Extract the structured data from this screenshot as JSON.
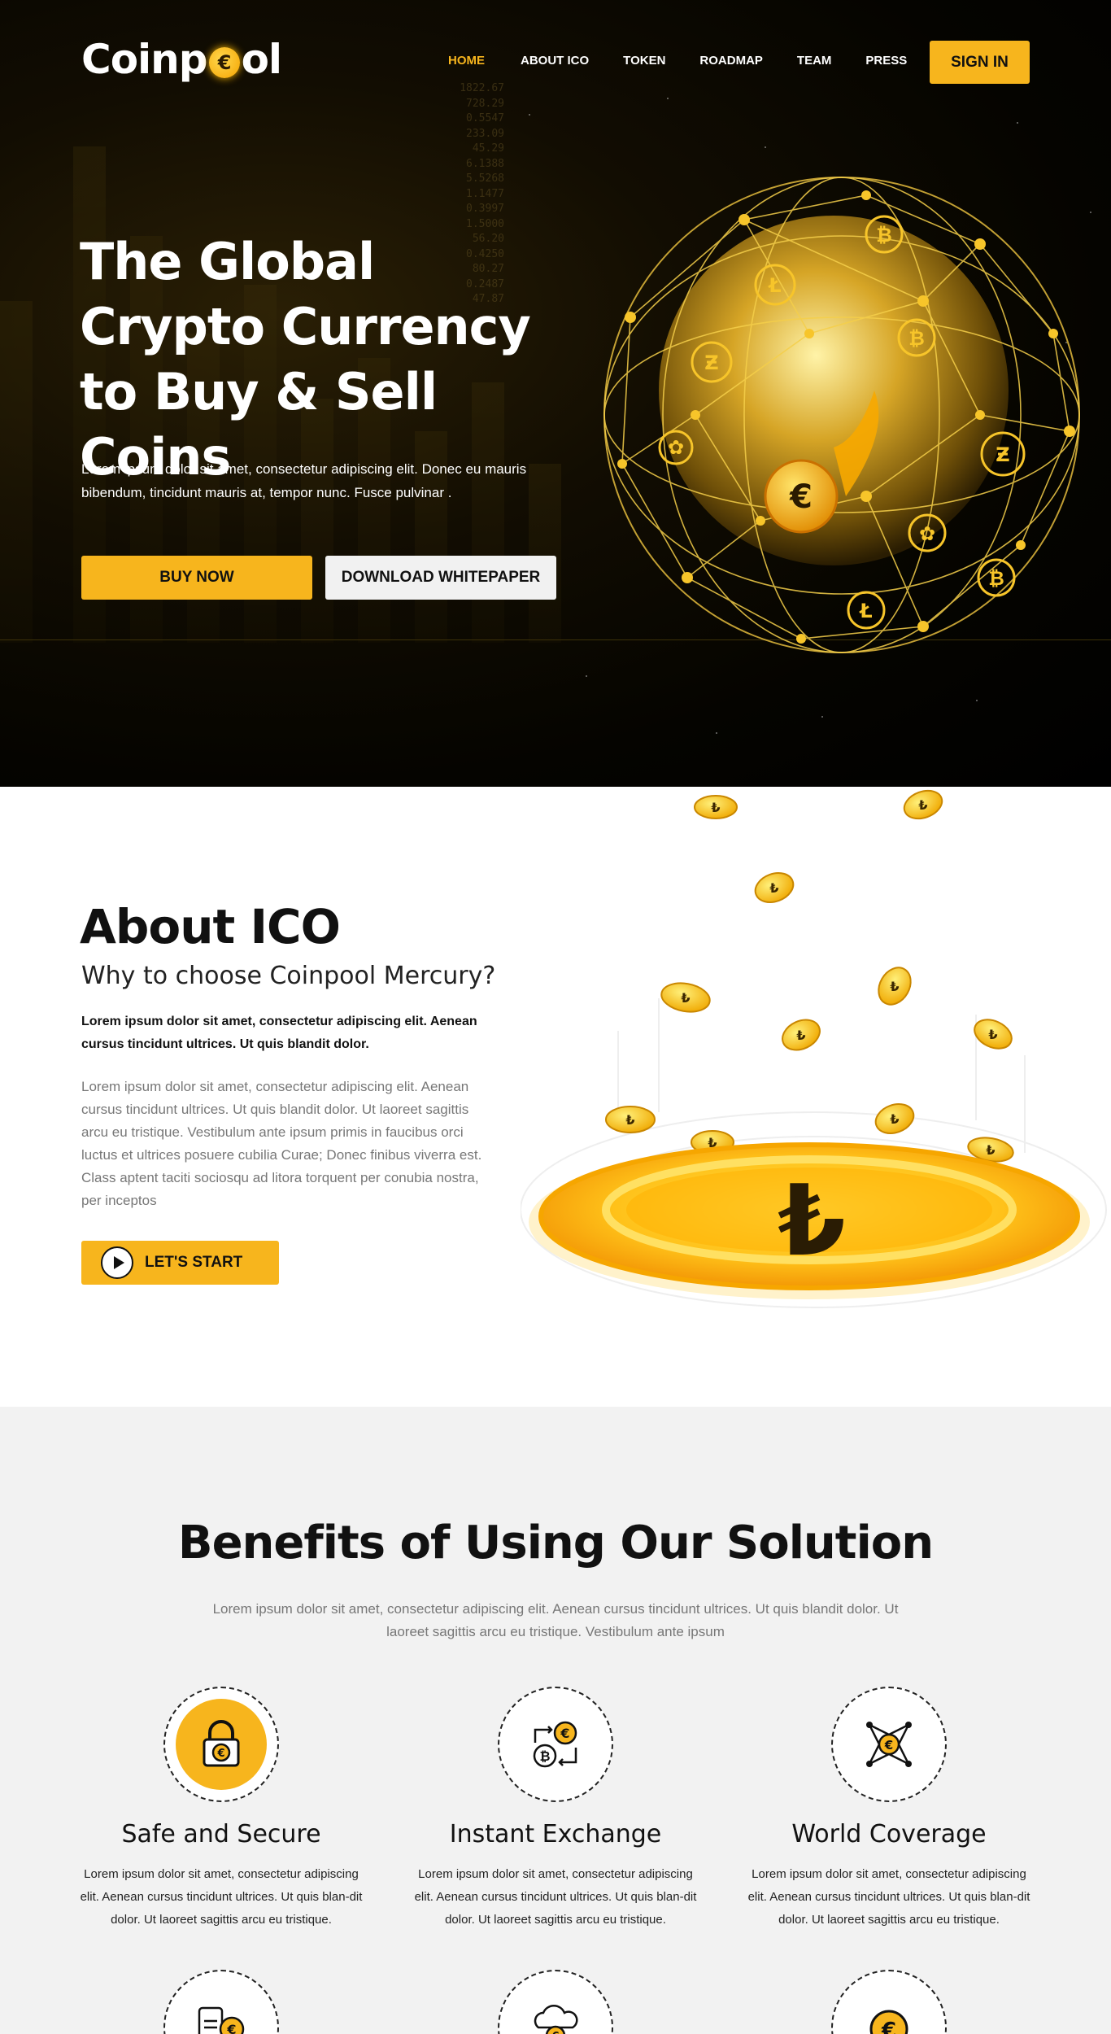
{
  "header": {
    "logo_left": "Coinp",
    "logo_coin": "€",
    "logo_right": "ol",
    "nav": [
      {
        "label": "HOME",
        "active": true
      },
      {
        "label": "ABOUT  ICO",
        "active": false
      },
      {
        "label": "TOKEN",
        "active": false
      },
      {
        "label": "ROADMAP",
        "active": false
      },
      {
        "label": "TEAM",
        "active": false
      },
      {
        "label": "PRESS",
        "active": false
      }
    ],
    "signin_label": "SIGN IN"
  },
  "hero": {
    "title_line1": "The Global",
    "title_line2": "Crypto Currency",
    "title_line3": "to Buy & Sell Coins",
    "text": "Lorem ipsum dolor sit amet, consectetur adipiscing elit. Donec eu mauris bibendum, tincidunt mauris at, tempor nunc. Fusce pulvinar .",
    "buy_label": "BUY NOW",
    "whitepaper_label": "DOWNLOAD WHITEPAPER",
    "ticker": [
      "1822.67",
      "728.29",
      "0.5547",
      "233.09",
      "45.29",
      "6.1388",
      "5.5268",
      "1.1477",
      "0.3997",
      "1.5000",
      "56.20",
      "0.4250",
      "80.27",
      "0.2487",
      "47.87"
    ]
  },
  "about": {
    "title": "About ICO",
    "subtitle": "Why to choose Coinpool Mercury?",
    "lead": "Lorem ipsum dolor sit amet, consectetur adipiscing elit. Aenean cursus tincidunt ultrices. Ut quis blandit dolor.",
    "body": "Lorem ipsum dolor sit amet, consectetur adipiscing elit. Aenean cursus tincidunt ultrices. Ut quis blandit dolor. Ut laoreet sagittis arcu eu tristique. Vestibulum ante ipsum primis in faucibus orci luctus et ultrices posuere cubilia Curae; Donec finibus viverra est. Class aptent taciti sociosqu ad litora torquent per conubia nostra, per inceptos",
    "start_label": "LET'S START",
    "big_coin_symbol": "₺"
  },
  "benefits": {
    "title": "Benefits of Using Our Solution",
    "intro": "Lorem ipsum dolor sit amet, consectetur adipiscing elit. Aenean cursus tincidunt ultrices. Ut quis blandit dolor. Ut laoreet sagittis arcu eu tristique. Vestibulum ante ipsum",
    "features": [
      {
        "title": "Safe and Secure",
        "text": "Lorem ipsum dolor sit amet, consectetur adipiscing elit. Aenean cursus tincidunt ultrices. Ut quis blan-dit dolor. Ut laoreet sagittis arcu eu tristique.",
        "icon": "lock-coin-icon"
      },
      {
        "title": "Instant Exchange",
        "text": "Lorem ipsum dolor sit amet, consectetur adipiscing elit. Aenean cursus tincidunt ultrices. Ut quis blan-dit dolor. Ut laoreet sagittis arcu eu tristique.",
        "icon": "exchange-icon"
      },
      {
        "title": "World Coverage",
        "text": "Lorem ipsum dolor sit amet, consectetur adipiscing elit. Aenean cursus tincidunt ultrices. Ut quis blan-dit dolor. Ut laoreet sagittis arcu eu tristique.",
        "icon": "network-coin-icon"
      }
    ]
  },
  "colors": {
    "accent": "#f7b51d",
    "dark": "#000000",
    "light_bg": "#f2f2f2"
  }
}
